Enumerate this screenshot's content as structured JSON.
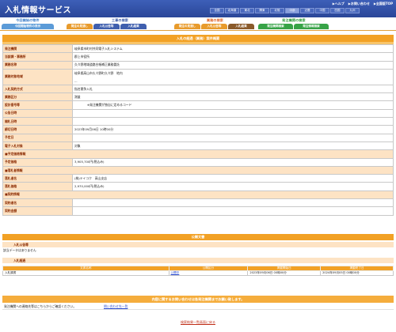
{
  "header": {
    "logo": "入札情報サービス",
    "links": [
      "▶ヘルプ",
      "▶お問い合わせ",
      "▶全国版TOP"
    ],
    "regions": [
      "全国",
      "北海道",
      "東北",
      "関東",
      "北陸",
      "中部",
      "近畿",
      "中国",
      "四国",
      "九州"
    ]
  },
  "nav": {
    "groups": [
      {
        "head": "今回開始の物件",
        "buttons": [
          "今回開始物件の表示"
        ]
      },
      {
        "head": "工事の検索",
        "buttons": [
          "発注の見通し",
          "入札公告等",
          "入札結果"
        ]
      },
      {
        "head": "業務の検索",
        "buttons": [
          "発注の見通し",
          "入札公告等",
          "入札結果"
        ]
      },
      {
        "head": "発注機関の検索",
        "buttons": [
          "発注機関検索",
          "発注情報検索"
        ]
      }
    ]
  },
  "detail": {
    "title": "入札の経過（業務）案件概要",
    "rows": [
      {
        "label": "発注機関",
        "value": "岐阜県市町村共同電子入札システム"
      },
      {
        "label": "当該課・事務所",
        "value": "郡上市役所"
      },
      {
        "label": "業務名称",
        "value": "久々野地域道路台帳補正業務委託"
      },
      {
        "label": "業務対象地域",
        "value": "岐阜県高山市久々野町久々野　地内",
        "value2": "..."
      },
      {
        "label": "入札契約方式",
        "value": "指名競争入札"
      },
      {
        "label": "業務区分",
        "value": "測量"
      },
      {
        "label": "設計番号等",
        "value": "※発注機関が独自に定めるコード"
      },
      {
        "label": "公告日時",
        "value": ""
      },
      {
        "label": "開札日時",
        "value": ""
      },
      {
        "label": "締切日時",
        "value": "2023年09月06日 10時00分"
      },
      {
        "label": "予定日",
        "value": ""
      },
      {
        "label": "電子入札対象",
        "value": "対象"
      }
    ],
    "price_head": "■予定価格情報",
    "price_rows": [
      {
        "label": "予定価格",
        "value": "3,905,700円(税込み)"
      }
    ],
    "winner_head": "■落札者情報",
    "winner_rows": [
      {
        "label": "落札者名",
        "value": "(株)テイコク　高山支店"
      },
      {
        "label": "落札価格",
        "value": "2,970,000円(税込み)"
      }
    ],
    "date_head": "■契約情報",
    "date_rows": [
      {
        "label": "契約者名",
        "value": ""
      },
      {
        "label": "契約金額",
        "value": ""
      }
    ]
  },
  "attachments": {
    "title": "公開文書",
    "notice_label": "入札公告等",
    "notice_text": "該当データはありません",
    "result_label": "入札経過",
    "columns": [
      "文書名称",
      "公開区分",
      "掲載開始日",
      "掲載終了日"
    ],
    "rows": [
      {
        "name": "入札調書",
        "type": "公開中",
        "start": "2023年09月06日 00時00分",
        "end": "2024年09月05日 00時00分"
      }
    ]
  },
  "contact": {
    "title": "内容に関するお問い合わせは各発注機関までお願い致します。",
    "text": "発注機関への連絡先等はこちらからご確認ください。",
    "link": "問い合わせ先一覧"
  },
  "back_link": "検索結果一覧画面に戻る",
  "colors": {
    "header": "#2a4698",
    "accent": "#f2a125",
    "label_bg": "#fde3c4"
  }
}
